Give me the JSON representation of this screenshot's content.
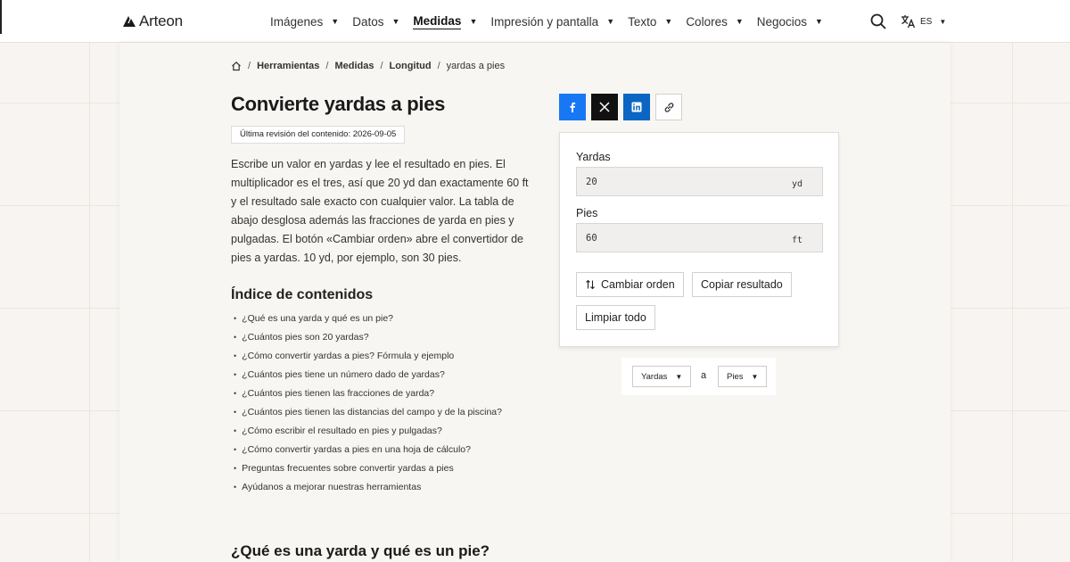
{
  "brand": {
    "name": "Arteon"
  },
  "nav": {
    "items": [
      {
        "label": "Imágenes"
      },
      {
        "label": "Datos"
      },
      {
        "label": "Medidas"
      },
      {
        "label": "Impresión y pantalla"
      },
      {
        "label": "Texto"
      },
      {
        "label": "Colores"
      },
      {
        "label": "Negocios"
      }
    ],
    "active": "Medidas",
    "language": "ES"
  },
  "breadcrumb": {
    "items": [
      "Herramientas",
      "Medidas",
      "Longitud"
    ],
    "current": "yardas a pies"
  },
  "page": {
    "title": "Convierte yardas a pies",
    "revision": "Última revisión del contenido: 2026-09-05",
    "intro": "Escribe un valor en yardas y lee el resultado en pies. El multiplicador es el tres, así que 20 yd dan exactamente 60 ft y el resultado sale exacto con cualquier valor. La tabla de abajo desglosa además las fracciones de yarda en pies y pulgadas. El botón «Cambiar orden» abre el convertidor de pies a yardas. 10 yd, por ejemplo, son 30 pies."
  },
  "toc": {
    "title": "Índice de contenidos",
    "items": [
      "¿Qué es una yarda y qué es un pie?",
      "¿Cuántos pies son 20 yardas?",
      "¿Cómo convertir yardas a pies? Fórmula y ejemplo",
      "¿Cuántos pies tiene un número dado de yardas?",
      "¿Cuántos pies tienen las fracciones de yarda?",
      "¿Cuántos pies tienen las distancias del campo y de la piscina?",
      "¿Cómo escribir el resultado en pies y pulgadas?",
      "¿Cómo convertir yardas a pies en una hoja de cálculo?",
      "Preguntas frecuentes sobre convertir yardas a pies",
      "Ayúdanos a mejorar nuestras herramientas"
    ]
  },
  "section": {
    "title": "¿Qué es una yarda y qué es un pie?"
  },
  "share": {
    "icons": [
      "facebook-icon",
      "x-icon",
      "linkedin-icon",
      "link-icon"
    ]
  },
  "converter": {
    "from_label": "Yardas",
    "from_value": "20",
    "from_unit": "yd",
    "to_label": "Pies",
    "to_value": "60",
    "to_unit": "ft",
    "swap_label": "Cambiar orden",
    "copy_label": "Copiar resultado",
    "clear_label": "Limpiar todo"
  },
  "unit_switch": {
    "from": "Yardas",
    "connector": "a",
    "to": "Pies"
  },
  "colors": {
    "facebook": "#1877f2",
    "x": "#111111",
    "linkedin": "#0a66c2",
    "page_bg": "#f7f4f1"
  }
}
